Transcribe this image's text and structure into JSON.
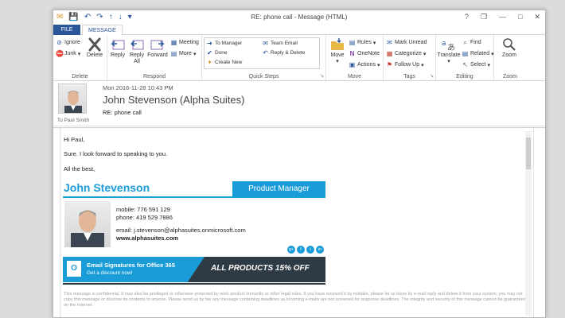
{
  "window": {
    "title": "RE: phone call - Message (HTML)",
    "controls": {
      "help": "?",
      "restore": "❐",
      "minimize": "—",
      "maximize": "□",
      "close": "✕"
    }
  },
  "qat": {
    "email": "✉",
    "save": "💾",
    "undo": "↶",
    "redo": "↷",
    "up": "↑",
    "down": "↓",
    "more": "▾"
  },
  "tabs": {
    "file": "FILE",
    "message": "MESSAGE"
  },
  "ribbon": {
    "delete_group": {
      "ignore": "Ignore",
      "junk": "Junk",
      "delete": "Delete",
      "label": "Delete"
    },
    "respond_group": {
      "reply": "Reply",
      "reply_all_1": "Reply",
      "reply_all_2": "All",
      "forward": "Forward",
      "meeting": "Meeting",
      "more": "More",
      "label": "Respond"
    },
    "quick_steps": {
      "to_manager": "To Manager",
      "team_email": "Team Email",
      "done": "Done",
      "reply_delete": "Reply & Delete",
      "create_new": "Create New",
      "label": "Quick Steps"
    },
    "move_group": {
      "move": "Move",
      "rules": "Rules",
      "onenote": "OneNote",
      "actions": "Actions",
      "label": "Move"
    },
    "tags_group": {
      "mark_unread": "Mark Unread",
      "categorize": "Categorize",
      "follow_up": "Follow Up",
      "label": "Tags"
    },
    "editing_group": {
      "translate": "Translate",
      "find": "Find",
      "related": "Related",
      "select": "Select",
      "label": "Editing"
    },
    "zoom_group": {
      "zoom": "Zoom",
      "label": "Zoom"
    }
  },
  "message": {
    "date": "Mon 2016-11-28 10:43 PM",
    "sender": "John Stevenson (Alpha Suites)",
    "subject": "RE: phone call",
    "to": "To Paul Smith"
  },
  "body": {
    "greeting": "Hi Paul,",
    "line1": "Sure. I look forward to speaking to you.",
    "closing": "All the best,"
  },
  "signature": {
    "name": "John Stevenson",
    "role": "Product Manager",
    "mobile": "mobile: 776 591 129",
    "phone": "phone: 419 529 7886",
    "email": "email: j.stevenson@alphasuites.onmicrosoft.com",
    "website": "www.alphasuites.com",
    "banner_title": "Email Signatures for Office 365",
    "banner_sub": "Get a discount now!",
    "banner_promo": "ALL PRODUCTS 15% OFF",
    "disclaimer": "This message is confidential. It may also be privileged or otherwise protected by work product immunity or other legal rules. If you have received it by mistake, please let us know by e-mail reply and delete it from your system; you may not copy this message or disclose its contents to anyone. Please send us by fax any message containing deadlines as incoming e-mails are not screened for response deadlines. The integrity and security of this message cannot be guaranteed on the Internet."
  },
  "colors": {
    "accent": "#2b579a",
    "brand": "#1a9cd8",
    "dark": "#2e3a44"
  }
}
